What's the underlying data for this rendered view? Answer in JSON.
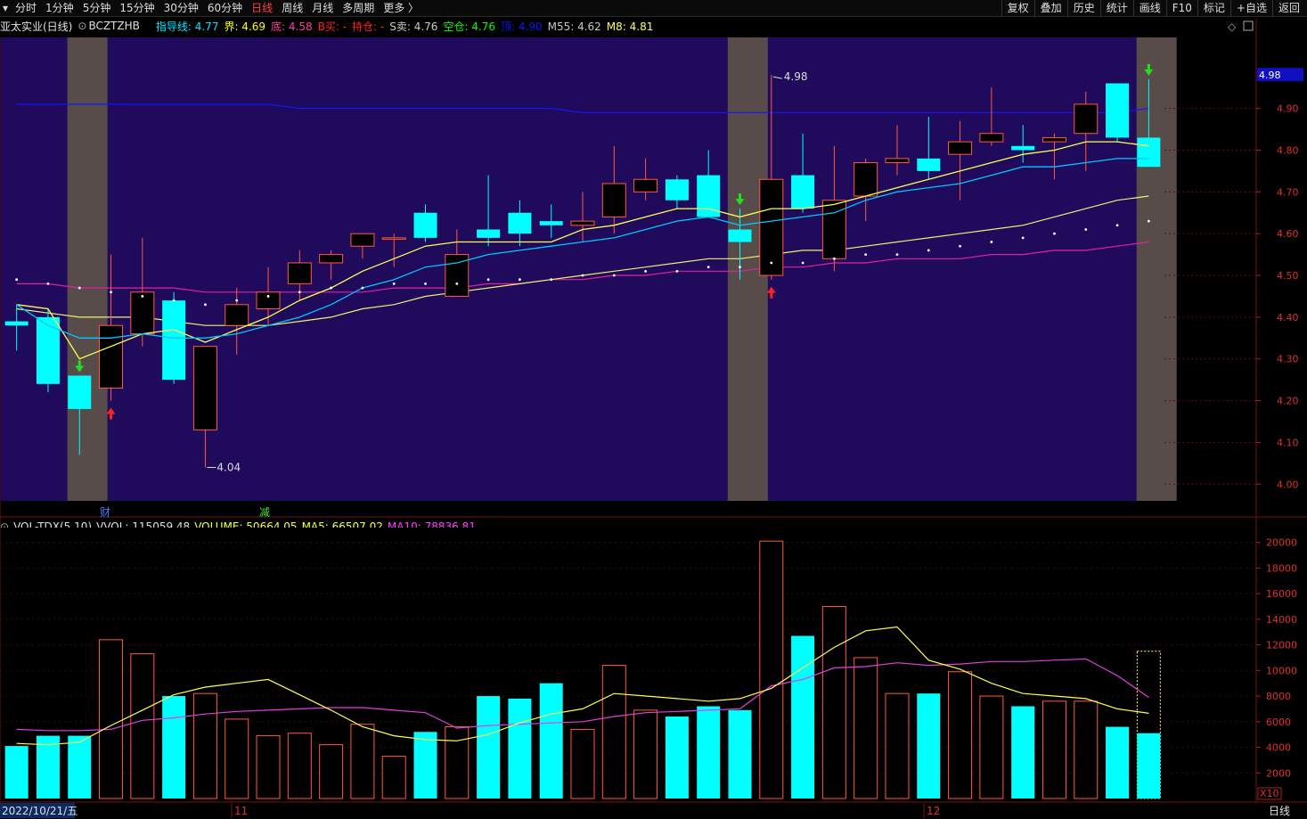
{
  "toolbar": {
    "period_tabs": [
      "分时",
      "1分钟",
      "5分钟",
      "15分钟",
      "30分钟",
      "60分钟",
      "日线",
      "周线",
      "月线",
      "多周期",
      "更多 〉"
    ],
    "active_tab": "日线",
    "right_buttons": [
      "复权",
      "叠加",
      "历史",
      "统计",
      "画线",
      "F10",
      "标记",
      "+自选",
      "返回"
    ]
  },
  "info": {
    "stock_name": "亚太实业(日线)",
    "indicator_name": "BCZTZHB",
    "items": [
      {
        "label": "指导线:",
        "value": "4.77",
        "color": "#00e5ff"
      },
      {
        "label": "界:",
        "value": "4.69",
        "color": "#ffff00"
      },
      {
        "label": "底:",
        "value": "4.58",
        "color": "#ff3ea0"
      },
      {
        "label": "B买:",
        "value": "-",
        "color": "#ff2020"
      },
      {
        "label": "持仓:",
        "value": "-",
        "color": "#ff2020"
      },
      {
        "label": "S卖:",
        "value": "4.76",
        "color": "#c8c8c8"
      },
      {
        "label": "空仓:",
        "value": "4.76",
        "color": "#00ff00"
      },
      {
        "label": "顶:",
        "value": "4.90",
        "color": "#1010ff"
      },
      {
        "label": "M55:",
        "value": "4.62",
        "color": "#c8c8c8"
      },
      {
        "label": "M8:",
        "value": "4.81",
        "color": "#ffff60"
      }
    ]
  },
  "price_axis": {
    "ticks": [
      "4.90",
      "4.80",
      "4.70",
      "4.60",
      "4.50",
      "4.40",
      "4.30",
      "4.20",
      "4.10",
      "4.00"
    ],
    "current_price": "4.98"
  },
  "price_annotations": {
    "high": "4.98",
    "low": "4.04"
  },
  "event_markers": {
    "cai": "财",
    "jian": "减"
  },
  "volume_info": {
    "name": "VOL-TDX(5,10)",
    "vvol": "VVOL: 115059.48",
    "volume": "VOLUME: 50664.05",
    "ma5": "MA5: 66507.02",
    "ma10": "MA10: 78836.81"
  },
  "volume_axis": {
    "ticks": [
      "20000",
      "18000",
      "16000",
      "14000",
      "12000",
      "10000",
      "8000",
      "6000",
      "4000",
      "2000"
    ],
    "unit": "X10"
  },
  "date_axis": {
    "start": "2022/10/21/五",
    "m11": "11",
    "m12": "12",
    "period": "日线"
  },
  "colors": {
    "up": "#ff5a40",
    "down": "#00ffff",
    "bg_panel": "#1f0a5c",
    "shade": "#574c4a",
    "ma_yellow": "#ffff50",
    "ma_cyan": "#00c8ff",
    "ma_blue": "#1515ff",
    "ma_magenta": "#e020a0"
  },
  "chart_data": {
    "type": "candlestick",
    "candles": [
      {
        "o": 4.39,
        "h": 4.43,
        "l": 4.32,
        "c": 4.38
      },
      {
        "o": 4.4,
        "h": 4.42,
        "l": 4.22,
        "c": 4.24
      },
      {
        "o": 4.26,
        "h": 4.26,
        "l": 4.07,
        "c": 4.18
      },
      {
        "o": 4.23,
        "h": 4.55,
        "l": 4.2,
        "c": 4.38
      },
      {
        "o": 4.36,
        "h": 4.59,
        "l": 4.33,
        "c": 4.46
      },
      {
        "o": 4.44,
        "h": 4.46,
        "l": 4.24,
        "c": 4.25
      },
      {
        "o": 4.13,
        "h": 4.33,
        "l": 4.04,
        "c": 4.33
      },
      {
        "o": 4.38,
        "h": 4.47,
        "l": 4.31,
        "c": 4.43
      },
      {
        "o": 4.42,
        "h": 4.52,
        "l": 4.38,
        "c": 4.46
      },
      {
        "o": 4.48,
        "h": 4.56,
        "l": 4.44,
        "c": 4.53
      },
      {
        "o": 4.53,
        "h": 4.56,
        "l": 4.49,
        "c": 4.55
      },
      {
        "o": 4.57,
        "h": 4.6,
        "l": 4.54,
        "c": 4.6
      },
      {
        "o": 4.59,
        "h": 4.6,
        "l": 4.52,
        "c": 4.59
      },
      {
        "o": 4.65,
        "h": 4.67,
        "l": 4.58,
        "c": 4.59
      },
      {
        "o": 4.45,
        "h": 4.61,
        "l": 4.45,
        "c": 4.55
      },
      {
        "o": 4.61,
        "h": 4.74,
        "l": 4.57,
        "c": 4.59
      },
      {
        "o": 4.65,
        "h": 4.68,
        "l": 4.57,
        "c": 4.6
      },
      {
        "o": 4.63,
        "h": 4.67,
        "l": 4.59,
        "c": 4.62
      },
      {
        "o": 4.62,
        "h": 4.7,
        "l": 4.58,
        "c": 4.63
      },
      {
        "o": 4.64,
        "h": 4.81,
        "l": 4.6,
        "c": 4.72
      },
      {
        "o": 4.7,
        "h": 4.78,
        "l": 4.68,
        "c": 4.73
      },
      {
        "o": 4.73,
        "h": 4.74,
        "l": 4.66,
        "c": 4.68
      },
      {
        "o": 4.74,
        "h": 4.8,
        "l": 4.64,
        "c": 4.64
      },
      {
        "o": 4.61,
        "h": 4.66,
        "l": 4.49,
        "c": 4.58
      },
      {
        "o": 4.5,
        "h": 4.98,
        "l": 4.49,
        "c": 4.73
      },
      {
        "o": 4.74,
        "h": 4.84,
        "l": 4.65,
        "c": 4.66
      },
      {
        "o": 4.54,
        "h": 4.81,
        "l": 4.51,
        "c": 4.68
      },
      {
        "o": 4.69,
        "h": 4.78,
        "l": 4.63,
        "c": 4.77
      },
      {
        "o": 4.77,
        "h": 4.86,
        "l": 4.74,
        "c": 4.78
      },
      {
        "o": 4.78,
        "h": 4.88,
        "l": 4.73,
        "c": 4.75
      },
      {
        "o": 4.79,
        "h": 4.87,
        "l": 4.68,
        "c": 4.82
      },
      {
        "o": 4.82,
        "h": 4.95,
        "l": 4.81,
        "c": 4.84
      },
      {
        "o": 4.81,
        "h": 4.86,
        "l": 4.77,
        "c": 4.8
      },
      {
        "o": 4.82,
        "h": 4.84,
        "l": 4.73,
        "c": 4.83
      },
      {
        "o": 4.84,
        "h": 4.94,
        "l": 4.75,
        "c": 4.91
      },
      {
        "o": 4.96,
        "h": 4.96,
        "l": 4.82,
        "c": 4.83
      },
      {
        "o": 4.83,
        "h": 4.97,
        "l": 4.76,
        "c": 4.76
      }
    ],
    "ma_yellow": [
      4.43,
      4.42,
      4.3,
      4.33,
      4.36,
      4.37,
      4.34,
      4.37,
      4.4,
      4.44,
      4.47,
      4.51,
      4.54,
      4.57,
      4.58,
      4.58,
      4.58,
      4.58,
      4.61,
      4.62,
      4.64,
      4.66,
      4.66,
      4.64,
      4.66,
      4.66,
      4.67,
      4.69,
      4.71,
      4.73,
      4.75,
      4.77,
      4.79,
      4.8,
      4.82,
      4.82,
      4.81
    ],
    "ma_cyan": [
      4.43,
      4.38,
      4.35,
      4.35,
      4.36,
      4.35,
      4.35,
      4.36,
      4.38,
      4.4,
      4.43,
      4.47,
      4.49,
      4.52,
      4.53,
      4.55,
      4.56,
      4.57,
      4.58,
      4.59,
      4.61,
      4.63,
      4.64,
      4.62,
      4.63,
      4.64,
      4.65,
      4.68,
      4.7,
      4.71,
      4.72,
      4.74,
      4.76,
      4.76,
      4.77,
      4.78,
      4.78
    ],
    "ma_light": [
      4.42,
      4.41,
      4.4,
      4.4,
      4.4,
      4.39,
      4.38,
      4.38,
      4.38,
      4.39,
      4.4,
      4.42,
      4.43,
      4.45,
      4.46,
      4.47,
      4.48,
      4.49,
      4.5,
      4.51,
      4.52,
      4.53,
      4.54,
      4.54,
      4.55,
      4.56,
      4.56,
      4.57,
      4.58,
      4.59,
      4.6,
      4.61,
      4.62,
      4.64,
      4.66,
      4.68,
      4.69
    ],
    "ma_magenta": [
      4.48,
      4.48,
      4.47,
      4.47,
      4.47,
      4.47,
      4.46,
      4.46,
      4.46,
      4.46,
      4.46,
      4.46,
      4.47,
      4.47,
      4.47,
      4.48,
      4.48,
      4.49,
      4.49,
      4.5,
      4.5,
      4.51,
      4.51,
      4.51,
      4.52,
      4.52,
      4.53,
      4.53,
      4.54,
      4.54,
      4.54,
      4.55,
      4.55,
      4.56,
      4.56,
      4.57,
      4.58
    ],
    "ma_blue": [
      4.91,
      4.91,
      4.91,
      4.91,
      4.91,
      4.91,
      4.91,
      4.91,
      4.91,
      4.9,
      4.9,
      4.9,
      4.9,
      4.9,
      4.9,
      4.9,
      4.9,
      4.9,
      4.89,
      4.89,
      4.89,
      4.89,
      4.89,
      4.89,
      4.89,
      4.89,
      4.89,
      4.89,
      4.89,
      4.89,
      4.89,
      4.89,
      4.89,
      4.89,
      4.89,
      4.89,
      4.9
    ],
    "dots": [
      4.49,
      4.48,
      4.47,
      4.46,
      4.45,
      4.44,
      4.43,
      4.44,
      4.45,
      4.46,
      4.47,
      4.47,
      4.48,
      4.48,
      4.48,
      4.49,
      4.49,
      4.49,
      4.5,
      4.5,
      4.51,
      4.51,
      4.52,
      4.52,
      4.53,
      4.53,
      4.54,
      4.55,
      4.55,
      4.56,
      4.57,
      4.58,
      4.59,
      4.6,
      4.61,
      4.62,
      4.63
    ],
    "volumes": [
      4100,
      4900,
      4900,
      12400,
      11300,
      8000,
      8200,
      6200,
      4900,
      5100,
      4200,
      5800,
      3300,
      5200,
      5600,
      8000,
      7800,
      9000,
      5400,
      10400,
      6900,
      6400,
      7200,
      6900,
      20100,
      12700,
      15000,
      11000,
      8200,
      8200,
      9900,
      8000,
      7200,
      7600,
      7600,
      5600,
      5100
    ],
    "vol_ma5": [
      4300,
      4200,
      4400,
      5700,
      6900,
      8100,
      8700,
      9000,
      9300,
      8100,
      6900,
      5600,
      4900,
      4600,
      4500,
      5000,
      5900,
      6600,
      7000,
      8200,
      8000,
      7800,
      7600,
      7800,
      8600,
      10200,
      11800,
      13100,
      13400,
      10800,
      10100,
      9000,
      8200,
      8000,
      7800,
      7000,
      6650
    ],
    "vol_ma10": [
      5400,
      5300,
      5300,
      5400,
      6100,
      6300,
      6600,
      6800,
      6900,
      7000,
      7100,
      7100,
      6900,
      6700,
      5500,
      5700,
      5800,
      5900,
      6000,
      6400,
      6700,
      6800,
      6900,
      7000,
      8800,
      9300,
      10200,
      10300,
      10600,
      10400,
      10500,
      10700,
      10700,
      10800,
      10900,
      9600,
      7900
    ],
    "buy_signals": [
      3,
      24
    ],
    "sell_signals": [
      2,
      23,
      36
    ],
    "shaded_bars": [
      2,
      23,
      36
    ],
    "price_range": [
      3.96,
      5.07
    ],
    "volume_range": [
      0,
      20600
    ]
  }
}
